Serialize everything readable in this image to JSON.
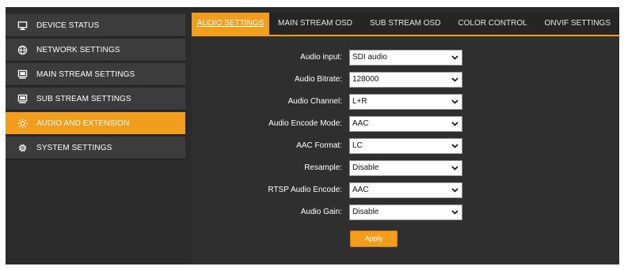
{
  "sidebar": {
    "items": [
      {
        "label": "DEVICE STATUS",
        "icon": "monitor-icon"
      },
      {
        "label": "NETWORK SETTINGS",
        "icon": "globe-icon"
      },
      {
        "label": "MAIN STREAM SETTINGS",
        "icon": "display-icon"
      },
      {
        "label": "SUB STREAM SETTINGS",
        "icon": "display-icon"
      },
      {
        "label": "AUDIO AND EXTENSION",
        "icon": "sun-icon",
        "active": true
      },
      {
        "label": "SYSTEM SETTINGS",
        "icon": "gear-icon"
      }
    ]
  },
  "tabs": [
    {
      "label": "AUDIO SETTINGS",
      "active": true
    },
    {
      "label": "MAIN STREAM OSD"
    },
    {
      "label": "SUB STREAM OSD"
    },
    {
      "label": "COLOR CONTROL"
    },
    {
      "label": "ONVIF SETTINGS"
    }
  ],
  "form": {
    "fields": [
      {
        "label": "Audio input:",
        "value": "SDI audio"
      },
      {
        "label": "Audio Bitrate:",
        "value": "128000"
      },
      {
        "label": "Audio Channel:",
        "value": "L+R"
      },
      {
        "label": "Audio Encode Mode:",
        "value": "AAC"
      },
      {
        "label": "AAC Format:",
        "value": "LC"
      },
      {
        "label": "Resample:",
        "value": "Disable"
      },
      {
        "label": "RTSP Audio Encode:",
        "value": "AAC"
      },
      {
        "label": "Audio Gain:",
        "value": "Disable"
      }
    ],
    "apply_label": "Apply"
  },
  "colors": {
    "accent": "#f29d1c",
    "background": "#2b2b2b",
    "sidebar_item": "#3c3c3c"
  }
}
